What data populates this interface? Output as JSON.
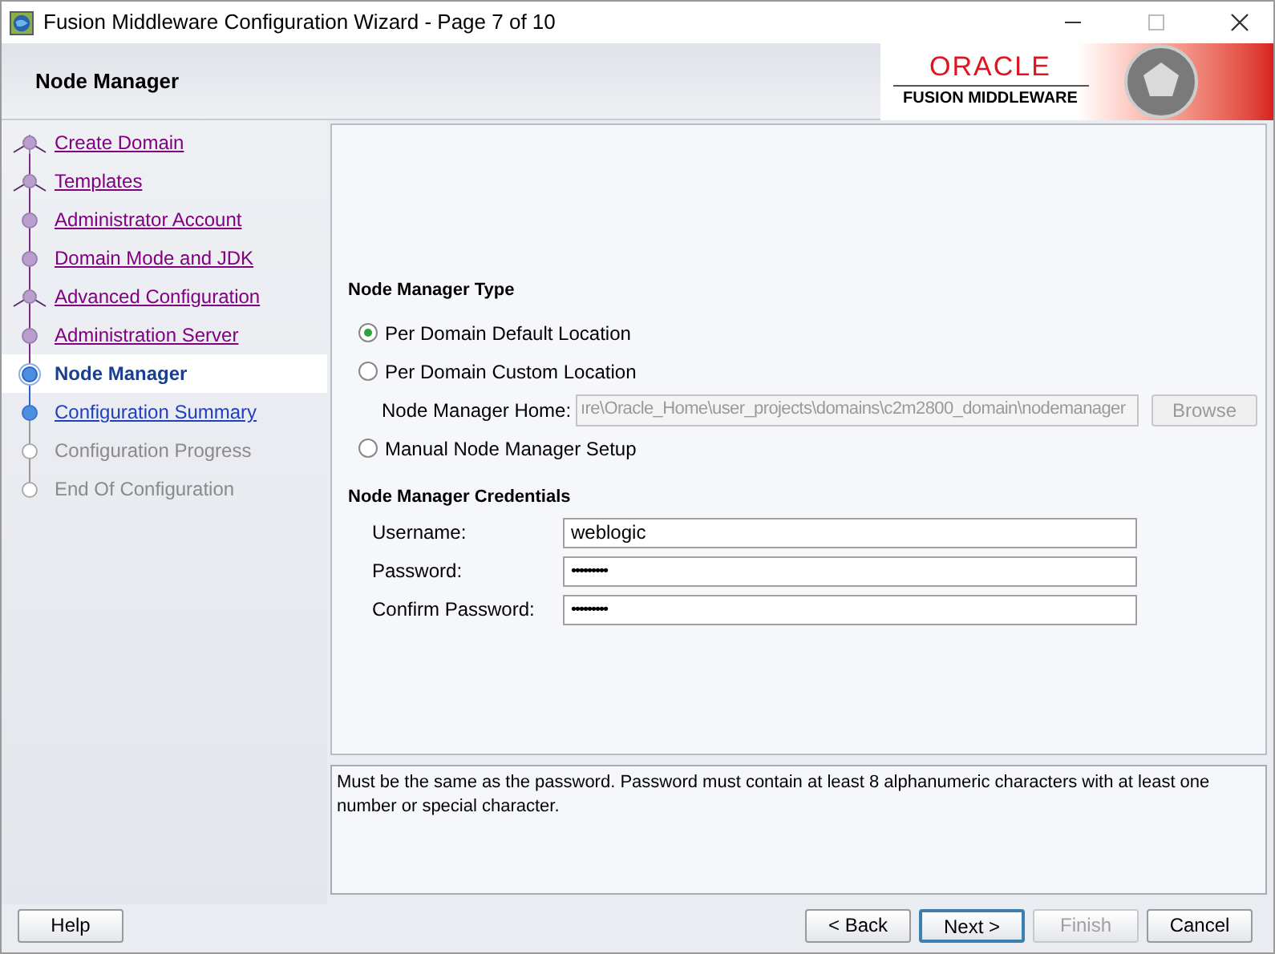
{
  "window": {
    "title": "Fusion Middleware Configuration Wizard - Page 7 of 10"
  },
  "header": {
    "title": "Node Manager",
    "logo_brand": "ORACLE",
    "logo_product": "FUSION MIDDLEWARE"
  },
  "steps": [
    {
      "label": "Create Domain",
      "visited": true,
      "selected": false,
      "disabled": false,
      "branch": true
    },
    {
      "label": "Templates",
      "visited": true,
      "selected": false,
      "disabled": false,
      "branch": true
    },
    {
      "label": "Administrator Account",
      "visited": true,
      "selected": false,
      "disabled": false,
      "branch": false
    },
    {
      "label": "Domain Mode and JDK",
      "visited": true,
      "selected": false,
      "disabled": false,
      "branch": false
    },
    {
      "label": "Advanced Configuration",
      "visited": true,
      "selected": false,
      "disabled": false,
      "branch": true
    },
    {
      "label": "Administration Server",
      "visited": true,
      "selected": false,
      "disabled": false,
      "branch": false
    },
    {
      "label": "Node Manager",
      "visited": false,
      "selected": true,
      "disabled": false,
      "branch": false
    },
    {
      "label": "Configuration Summary",
      "visited": false,
      "selected": false,
      "disabled": false,
      "branch": false
    },
    {
      "label": "Configuration Progress",
      "visited": false,
      "selected": false,
      "disabled": true,
      "branch": false
    },
    {
      "label": "End Of Configuration",
      "visited": false,
      "selected": false,
      "disabled": true,
      "branch": false
    }
  ],
  "node_manager_type": {
    "heading": "Node Manager Type",
    "options": [
      {
        "label": "Per Domain Default Location",
        "selected": true
      },
      {
        "label": "Per Domain Custom Location",
        "selected": false
      },
      {
        "label": "Manual Node Manager Setup",
        "selected": false
      }
    ],
    "home": {
      "label": "Node Manager Home:",
      "value": "ıre\\Oracle_Home\\user_projects\\domains\\c2m2800_domain\\nodemanager",
      "disabled": true
    },
    "browse": {
      "label": "Browse",
      "disabled": true
    }
  },
  "credentials": {
    "heading": "Node Manager Credentials",
    "fields": [
      {
        "label": "Username:",
        "value": "weblogic",
        "kind": "text"
      },
      {
        "label": "Password:",
        "value": "•••••••••",
        "kind": "password"
      },
      {
        "label": "Confirm Password:",
        "value": "•••••••••",
        "kind": "password"
      }
    ]
  },
  "help_text": "Must be the same as the password. Password must contain at least 8 alphanumeric characters with at least one number or special character.",
  "buttons": [
    {
      "label": "Help",
      "disabled": false,
      "default": false
    },
    {
      "label": "< Back",
      "disabled": false,
      "default": false
    },
    {
      "label": "Next >",
      "disabled": false,
      "default": true
    },
    {
      "label": "Finish",
      "disabled": true,
      "default": false
    },
    {
      "label": "Cancel",
      "disabled": false,
      "default": false
    }
  ]
}
